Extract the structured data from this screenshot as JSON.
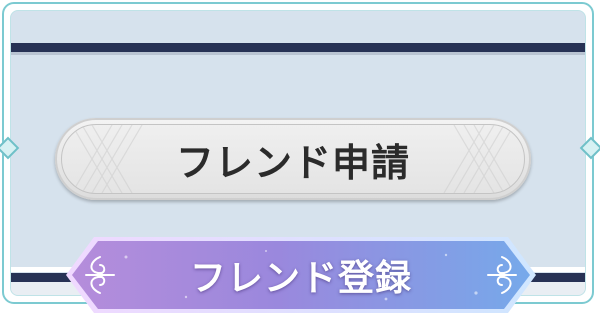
{
  "friend_request_button": {
    "label": "フレンド申請"
  },
  "banner": {
    "title": "フレンド登録"
  },
  "colors": {
    "frame": "#7ccad1",
    "panel": "#d6e2ed",
    "navy_bar": "#273255",
    "button_face": "#e8e8e8",
    "button_text": "#2b2b2b",
    "banner_purple": "#a080d6",
    "banner_blue": "#7aa8e6",
    "banner_text": "#ffffff"
  },
  "icons": {
    "side_ornaments": "diamond-gem-icon",
    "banner_ornaments": "flourish-scroll-icon"
  }
}
